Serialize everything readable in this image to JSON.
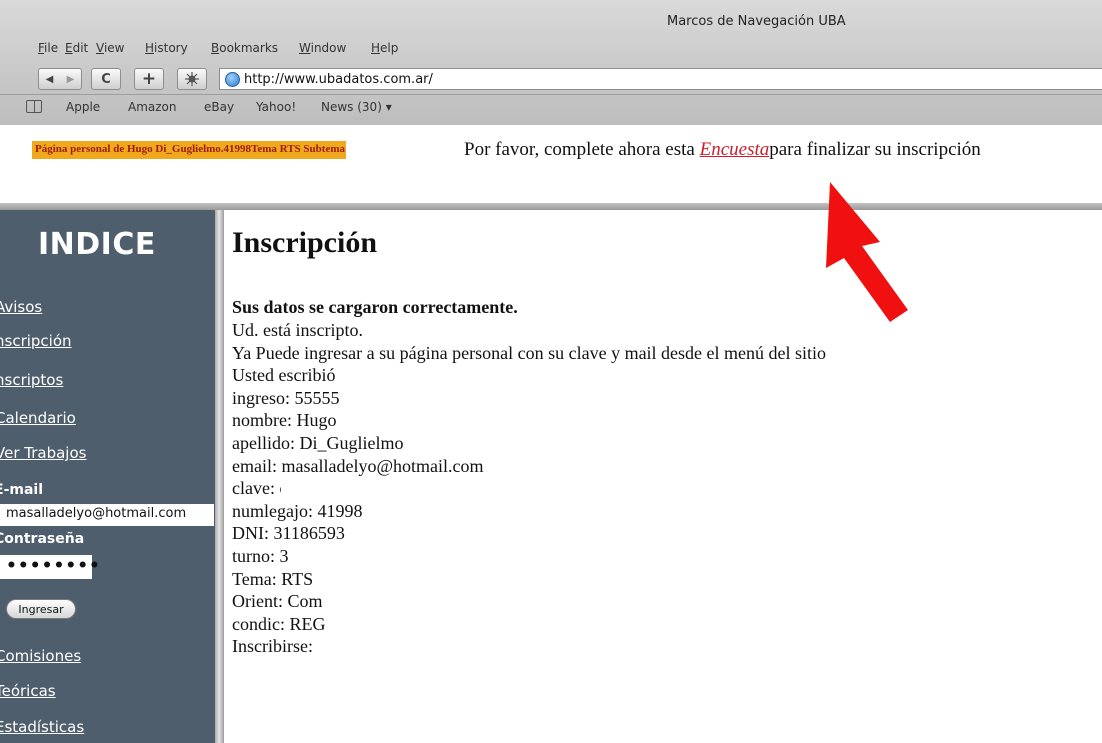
{
  "window": {
    "title": "Marcos de Navegación UBA"
  },
  "menu": [
    "File",
    "Edit",
    "View",
    "History",
    "Bookmarks",
    "Window",
    "Help"
  ],
  "toolbar": {
    "back": "◀",
    "forward": "▶",
    "reload": "C",
    "add": "+",
    "url": "http://www.ubadatos.com.ar/"
  },
  "bookmarks": [
    "Apple",
    "Amazon",
    "eBay",
    "Yahoo!",
    "News (30) ▾"
  ],
  "top": {
    "label": "Página personal de Hugo Di_Guglielmo.41998Tema RTS Subtema",
    "notice_before": "Por favor, complete ahora esta ",
    "notice_link": "Encuesta",
    "notice_after": "para finalizar su inscripción"
  },
  "sidebar": {
    "heading": "INDICE",
    "links": [
      "Avisos",
      "nscripción",
      "nscriptos",
      "Calendario",
      "Ver Trabajos"
    ],
    "email_label": "E-mail",
    "email_value": "masalladelyo@hotmail.com",
    "password_label": "Contraseña",
    "password_value": "••••••••",
    "login_button": "Ingresar",
    "links_bottom": [
      "Comisiones",
      "Teóricas",
      "Estadísticas"
    ]
  },
  "main": {
    "title": "Inscripción",
    "success": "Sus datos se cargaron correctamente.",
    "lines": [
      "Ud. está inscripto.",
      "Ya Puede ingresar a su página personal con su clave y mail desde el menú del sitio",
      "Usted escribió",
      "ingreso: 55555",
      "nombre: Hugo",
      "apellido: Di_Guglielmo",
      "email: masalladelyo@hotmail.com",
      "clave: c",
      "numlegajo: 41998",
      "DNI: 31186593",
      "turno: 3",
      "Tema: RTS",
      "Orient: Com",
      "condic: REG",
      "Inscribirse:"
    ]
  },
  "colors": {
    "sidebar": "#4f5e6d",
    "label_bg": "#f0a91c",
    "label_text": "#9e1c12",
    "link": "#cc1d2c",
    "arrow": "#f01010"
  }
}
